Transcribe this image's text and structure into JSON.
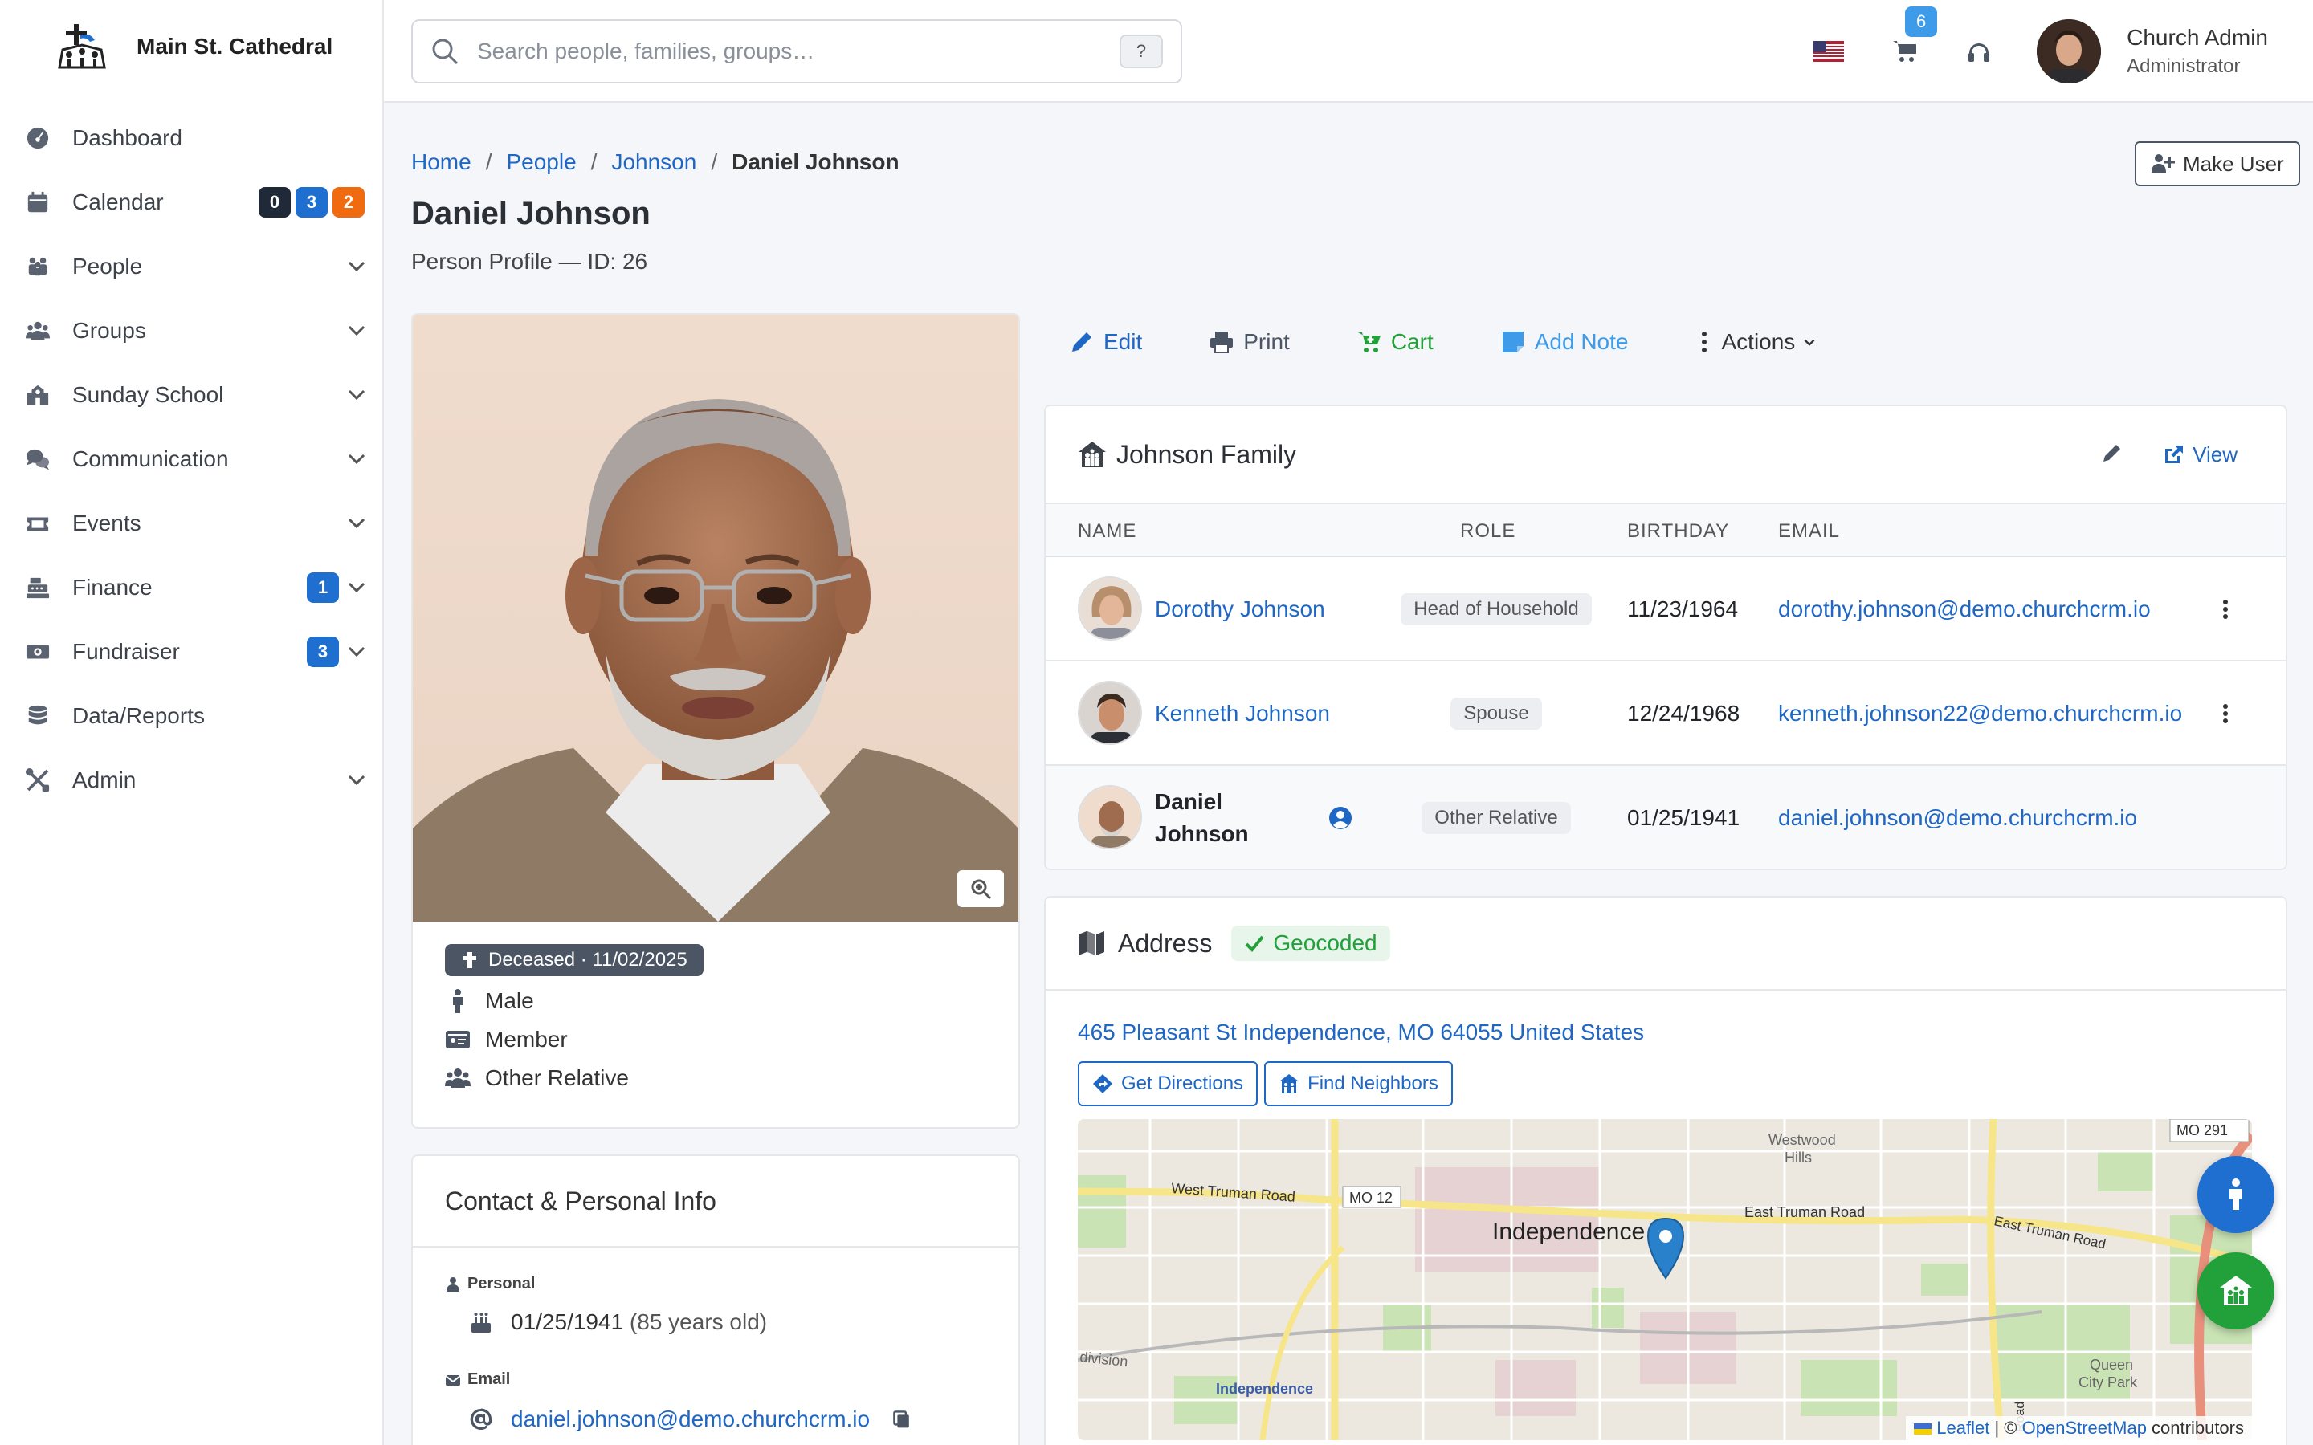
{
  "brand": {
    "name": "Main St. Cathedral"
  },
  "sidebar": {
    "items": [
      {
        "label": "Dashboard"
      },
      {
        "label": "Calendar",
        "badges": [
          "0",
          "3",
          "2"
        ]
      },
      {
        "label": "People"
      },
      {
        "label": "Groups"
      },
      {
        "label": "Sunday School"
      },
      {
        "label": "Communication"
      },
      {
        "label": "Events"
      },
      {
        "label": "Finance",
        "badge": "1"
      },
      {
        "label": "Fundraiser",
        "badge": "3"
      },
      {
        "label": "Data/Reports"
      },
      {
        "label": "Admin"
      }
    ]
  },
  "search": {
    "placeholder": "Search people, families, groups…",
    "shortcut": "?"
  },
  "topbar": {
    "cart_count": "6",
    "user_name": "Church Admin",
    "user_role": "Administrator"
  },
  "breadcrumb": {
    "home": "Home",
    "people": "People",
    "family": "Johnson",
    "current": "Daniel Johnson",
    "sep": "/"
  },
  "page": {
    "title": "Daniel Johnson",
    "subtitle": "Person Profile — ID: 26",
    "make_user": "Make User"
  },
  "profile": {
    "deceased": "Deceased · 11/02/2025",
    "gender": "Male",
    "classification": "Member",
    "family_role": "Other Relative"
  },
  "contact": {
    "title": "Contact & Personal Info",
    "personal_label": "Personal",
    "birthdate": "01/25/1941",
    "age": "(85 years old)",
    "email_label": "Email",
    "email": "daniel.johnson@demo.churchcrm.io"
  },
  "actions": {
    "edit": "Edit",
    "print": "Print",
    "cart": "Cart",
    "note": "Add Note",
    "more": "Actions"
  },
  "family": {
    "title": "Johnson Family",
    "view": "View",
    "columns": {
      "name": "NAME",
      "role": "ROLE",
      "birthday": "BIRTHDAY",
      "email": "EMAIL"
    },
    "members": [
      {
        "first": "Dorothy Johnson",
        "role": "Head of Household",
        "birthday": "11/23/1964",
        "email": "dorothy.johnson@demo.churchcrm.io"
      },
      {
        "first": "Kenneth Johnson",
        "role": "Spouse",
        "birthday": "12/24/1968",
        "email": "kenneth.johnson22@demo.churchcrm.io"
      },
      {
        "first": "Daniel",
        "last": "Johnson",
        "role": "Other Relative",
        "birthday": "01/25/1941",
        "email": "daniel.johnson@demo.churchcrm.io"
      }
    ]
  },
  "address": {
    "title": "Address",
    "status": "Geocoded",
    "line": "465 Pleasant St Independence, MO 64055 United States",
    "directions": "Get Directions",
    "neighbors": "Find Neighbors",
    "map_labels": {
      "city": "Independence",
      "road1": "West Truman Road",
      "road2": "East Truman Road",
      "road3": "East Truman Road",
      "hwy": "MO 12",
      "hwy2": "MO 291",
      "area1": "Westwood",
      "area1b": "Hills",
      "area2": "Queen",
      "area2b": "City Park",
      "division": "division",
      "station": "Independence",
      "road_v": "Road"
    },
    "attribution": {
      "leaflet": "Leaflet",
      "sep": " | © ",
      "osm": "OpenStreetMap",
      "rest": " contributors"
    }
  },
  "colors": {
    "primary": "#1f67c4",
    "success": "#22a13a",
    "badge_dark": "#1f2937",
    "badge_blue": "#1f6fd1",
    "badge_orange": "#f06a10"
  }
}
